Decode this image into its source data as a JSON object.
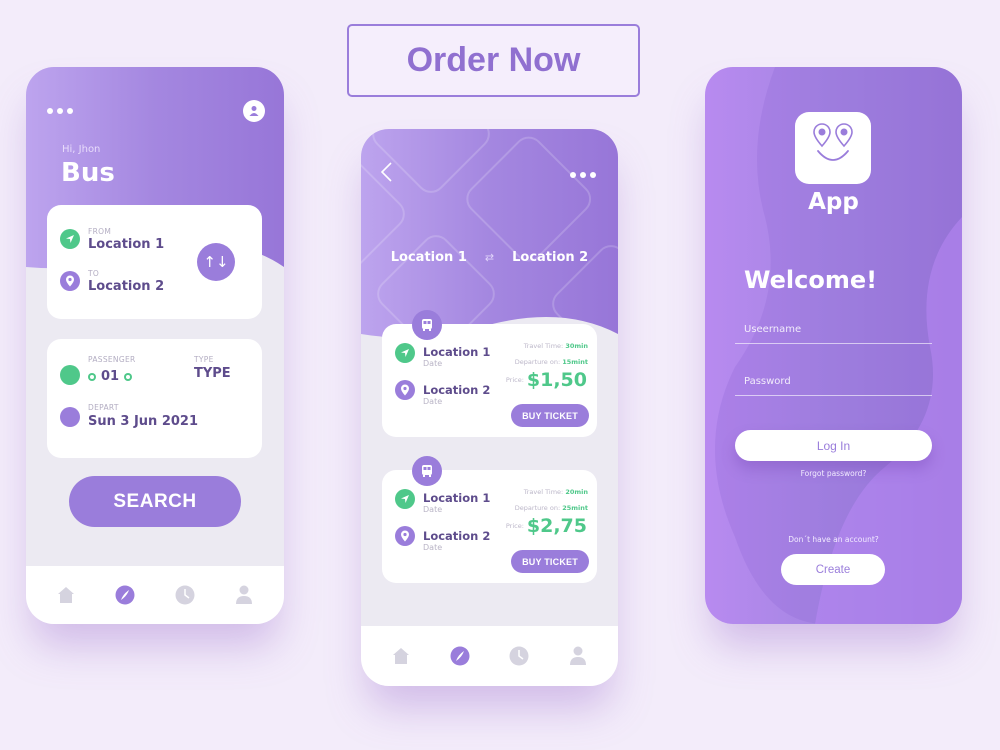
{
  "colors": {
    "primary": "#9a7ddb",
    "accent_green": "#4fc88a",
    "background": "#f3ecfa",
    "text_dark": "#5e4c8c",
    "tab_inactive": "#d5d3df"
  },
  "order_button": {
    "label": "Order Now"
  },
  "search_screen": {
    "menu_icon": "more-dots-icon",
    "profile_icon": "user-icon",
    "greeting": "Hi, Jhon",
    "title": "Bus",
    "route": {
      "from_label": "FROM",
      "from_value": "Location 1",
      "to_label": "TO",
      "to_value": "Location 2",
      "swap_icon": "swap-vertical-icon",
      "swap_glyph": "↑↓"
    },
    "passenger": {
      "label": "PASSENGER",
      "value": "01",
      "type_label": "TYPE",
      "type_value": "TYPE",
      "depart_label": "DEPART",
      "depart_value": "Sun 3 Jun 2021"
    },
    "search_label": "SEARCH",
    "tabs": [
      {
        "name": "home",
        "icon": "home-icon",
        "active": false
      },
      {
        "name": "explore",
        "icon": "compass-icon",
        "active": true
      },
      {
        "name": "history",
        "icon": "clock-icon",
        "active": false
      },
      {
        "name": "profile",
        "icon": "user-icon",
        "active": false
      }
    ]
  },
  "results_screen": {
    "back_icon": "chevron-left-icon",
    "menu_icon": "more-dots-icon",
    "from": "Location 1",
    "to": "Location 2",
    "swap_glyph": "⇄",
    "tickets": [
      {
        "from": "Location 1",
        "from_date": "Date",
        "to": "Location 2",
        "to_date": "Date",
        "travel_time_label": "Travel Time:",
        "travel_time": "30min",
        "departure_label": "Departure on:",
        "departure": "15mint",
        "price_label": "Price:",
        "price": "$1,50",
        "buy_label": "BUY TICKET"
      },
      {
        "from": "Location 1",
        "from_date": "Date",
        "to": "Location 2",
        "to_date": "Date",
        "travel_time_label": "Travel Time:",
        "travel_time": "20min",
        "departure_label": "Departure on:",
        "departure": "25mint",
        "price_label": "Price:",
        "price": "$2,75",
        "buy_label": "BUY TICKET"
      }
    ],
    "tabs": [
      {
        "name": "home",
        "icon": "home-icon",
        "active": false
      },
      {
        "name": "explore",
        "icon": "compass-icon",
        "active": true
      },
      {
        "name": "history",
        "icon": "clock-icon",
        "active": false
      },
      {
        "name": "profile",
        "icon": "user-icon",
        "active": false
      }
    ]
  },
  "login_screen": {
    "app_name": "App",
    "welcome": "Welcome!",
    "username_placeholder": "Useername",
    "password_placeholder": "Password",
    "login_label": "Log In",
    "forgot_label": "Forgot password?",
    "no_account_label": "Don´t have an account?",
    "create_label": "Create"
  }
}
